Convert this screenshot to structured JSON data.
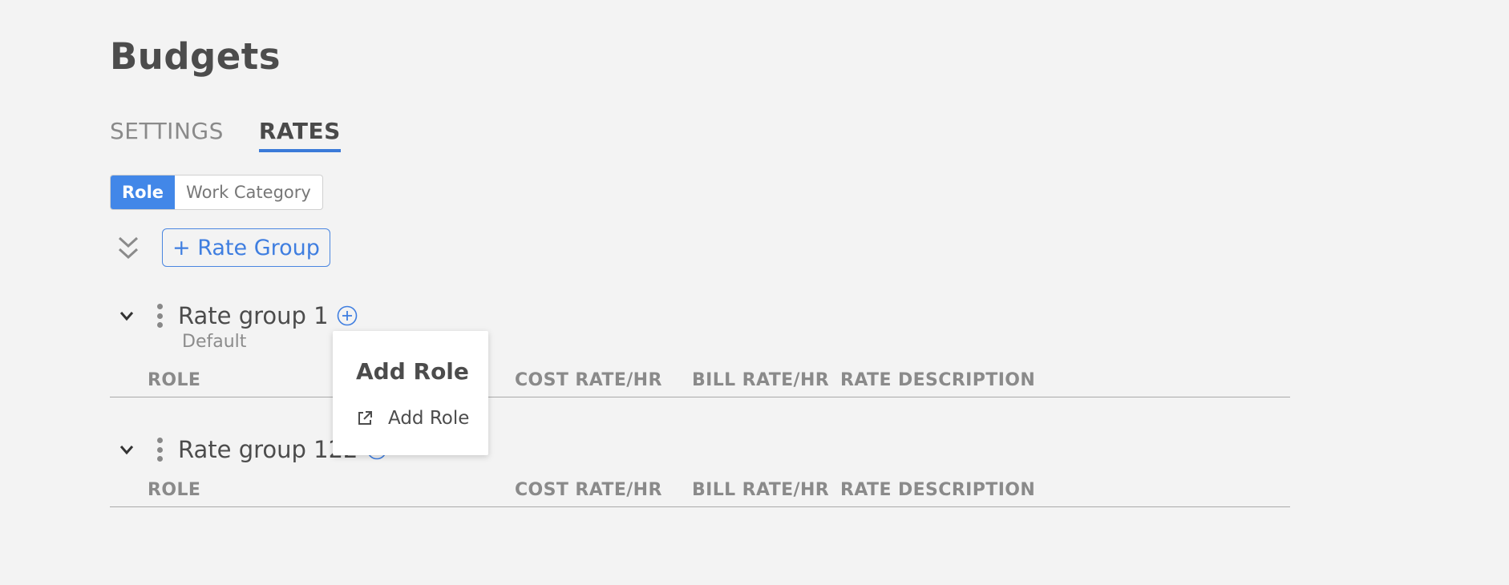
{
  "page": {
    "title": "Budgets"
  },
  "tabs": [
    {
      "label": "SETTINGS",
      "active": false
    },
    {
      "label": "RATES",
      "active": true
    }
  ],
  "toggle": {
    "options": [
      "Role",
      "Work Category"
    ],
    "selected": "Role"
  },
  "toolbar": {
    "add_rate_group_label": "+ Rate Group"
  },
  "rate_groups": [
    {
      "name": "Rate group 1",
      "subtitle": "Default",
      "columns": [
        "ROLE",
        "COST RATE/HR",
        "BILL RATE/HR",
        "RATE DESCRIPTION"
      ]
    },
    {
      "name": "Rate group 122",
      "columns": [
        "ROLE",
        "COST RATE/HR",
        "BILL RATE/HR",
        "RATE DESCRIPTION"
      ]
    }
  ],
  "popover": {
    "title": "Add Role",
    "item_label": "Add Role"
  },
  "colors": {
    "accent": "#4287e8",
    "background": "#f3f3f3"
  }
}
